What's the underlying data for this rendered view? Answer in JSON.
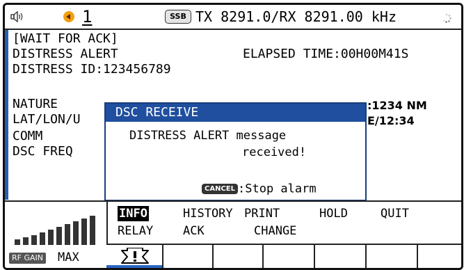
{
  "status_bar": {
    "speaker_icon": "speaker-icon",
    "channel_icon": "channel-mode-icon",
    "channel_number": "1",
    "mode_badge": "SSB",
    "frequency": "TX 8291.0/RX 8291.00 kHz",
    "busy_icon": "spinner-icon"
  },
  "main": {
    "line1": "[WAIT FOR ACK]",
    "line2": "DISTRESS ALERT",
    "elapsed": "ELAPSED TIME:00H00M41S",
    "line3": "DISTRESS ID:123456789",
    "label_nature": "NATURE",
    "label_latlon": "LAT/LON/U",
    "label_comm": "COMM",
    "label_dscfreq": "DSC FREQ",
    "distance_fragment": ":1234 NM",
    "time_fragment": "E/12:34"
  },
  "popup": {
    "title": "DSC RECEIVE",
    "message_line1": "DISTRESS ALERT message",
    "message_line2": "received!",
    "cancel_key": "CANCEL",
    "cancel_action": ":Stop alarm"
  },
  "rf_gain": {
    "badge": "RF GAIN",
    "level": "MAX",
    "bars_total": 10,
    "bars_filled": 10
  },
  "menu": {
    "row1": {
      "info": "INFO",
      "history": "HISTORY",
      "print": "PRINT",
      "hold": "HOLD",
      "quit": "QUIT"
    },
    "row2": {
      "relay": "RELAY",
      "ack": "ACK",
      "change": "CHANGE"
    }
  },
  "colors": {
    "accent_blue": "#1f4f9e",
    "left_rule_blue": "#2a5fb0",
    "channel_orange": "#f2a010"
  },
  "bottom_strip": {
    "active_icon": "distress-alert-icon"
  }
}
